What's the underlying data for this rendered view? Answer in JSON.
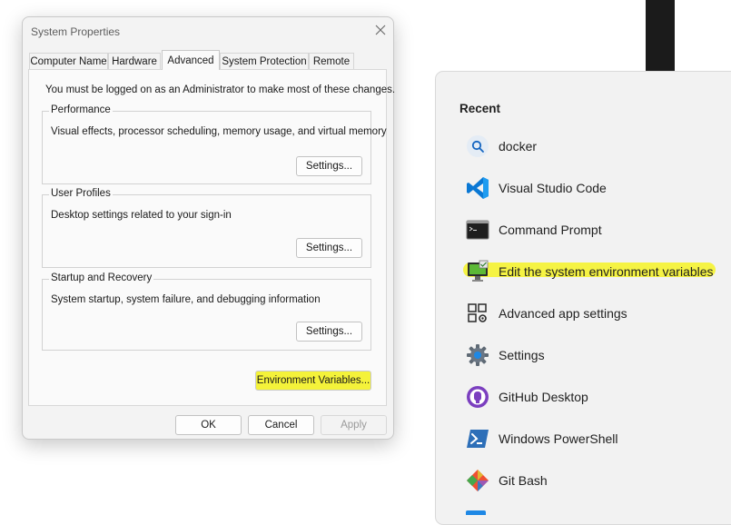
{
  "dialog": {
    "title": "System Properties",
    "tabs": [
      "Computer Name",
      "Hardware",
      "Advanced",
      "System Protection",
      "Remote"
    ],
    "active_tab": "Advanced",
    "admin_note": "You must be logged on as an Administrator to make most of these changes.",
    "groups": [
      {
        "label": "Performance",
        "description": "Visual effects, processor scheduling, memory usage, and virtual memory",
        "button": "Settings..."
      },
      {
        "label": "User Profiles",
        "description": "Desktop settings related to your sign-in",
        "button": "Settings..."
      },
      {
        "label": "Startup and Recovery",
        "description": "System startup, system failure, and debugging information",
        "button": "Settings..."
      }
    ],
    "env_button": "Environment Variables...",
    "ok": "OK",
    "cancel": "Cancel",
    "apply": "Apply",
    "highlight_color": "#f4f23a"
  },
  "start_menu": {
    "section_title": "Recent",
    "items": [
      {
        "label": "docker",
        "icon": "search-icon"
      },
      {
        "label": "Visual Studio Code",
        "icon": "vscode-icon"
      },
      {
        "label": "Command Prompt",
        "icon": "command-prompt-icon"
      },
      {
        "label": "Edit the system environment variables",
        "icon": "system-monitor-icon",
        "highlighted": true
      },
      {
        "label": "Advanced app settings",
        "icon": "app-settings-icon"
      },
      {
        "label": "Settings",
        "icon": "gear-icon"
      },
      {
        "label": "GitHub Desktop",
        "icon": "github-desktop-icon"
      },
      {
        "label": "Windows PowerShell",
        "icon": "powershell-icon"
      },
      {
        "label": "Git Bash",
        "icon": "git-bash-icon"
      }
    ]
  }
}
